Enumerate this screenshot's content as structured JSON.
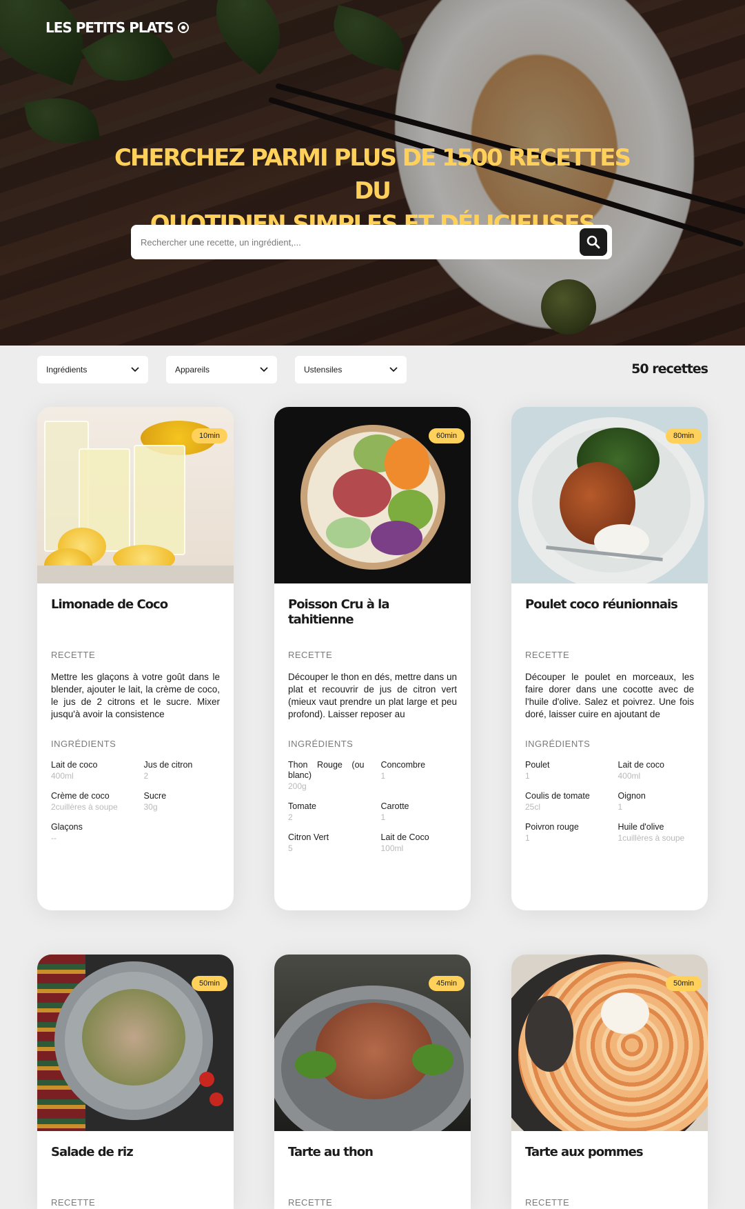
{
  "header": {
    "logo": "LES PETITS PLATS",
    "logo_icon": "target-icon",
    "headline_line1": "CHERCHEZ PARMI PLUS DE 1500 RECETTES DU",
    "headline_line2": "QUOTIDIEN,SIMPLES ET DÉLICIEUSES",
    "accent_color": "#FFD15B"
  },
  "search": {
    "placeholder": "Rechercher une recette, un ingrédient,...",
    "value": "",
    "icon": "search-icon"
  },
  "filters": [
    {
      "label": "Ingrédients",
      "icon": "chevron-down-icon"
    },
    {
      "label": "Appareils",
      "icon": "chevron-down-icon"
    },
    {
      "label": "Ustensiles",
      "icon": "chevron-down-icon"
    }
  ],
  "recipes_count": "50 recettes",
  "section_labels": {
    "recipe": "RECETTE",
    "ingredients": "INGRÉDIENTS"
  },
  "recipes": [
    {
      "time": "10min",
      "title": "Limonade de Coco",
      "description": "Mettre les glaçons à votre goût dans le blender, ajouter le lait, la crème de coco, le jus de 2 citrons et le sucre. Mixer jusqu'à avoir la consistence",
      "ingredients": [
        {
          "name": "Lait de coco",
          "qty": "400ml"
        },
        {
          "name": "Jus de citron",
          "qty": "2"
        },
        {
          "name": "Crème de coco",
          "qty": "2cuillères à soupe"
        },
        {
          "name": "Sucre",
          "qty": "30g"
        },
        {
          "name": "Glaçons",
          "qty": "--"
        }
      ]
    },
    {
      "time": "60min",
      "title": "Poisson Cru à la tahitienne",
      "description": "Découper le thon en dés, mettre dans un plat et recouvrir de jus de citron vert (mieux vaut prendre un plat large et peu profond). Laisser reposer au",
      "ingredients": [
        {
          "name": "Thon Rouge (ou blanc)",
          "qty": "200g"
        },
        {
          "name": "Concombre",
          "qty": "1"
        },
        {
          "name": "Tomate",
          "qty": "2"
        },
        {
          "name": "Carotte",
          "qty": "1"
        },
        {
          "name": "Citron Vert",
          "qty": "5"
        },
        {
          "name": "Lait de Coco",
          "qty": "100ml"
        }
      ]
    },
    {
      "time": "80min",
      "title": "Poulet coco réunionnais",
      "description": "Découper le poulet en morceaux, les faire dorer dans une cocotte avec de l'huile d'olive. Salez et poivrez. Une fois doré, laisser cuire en ajoutant de",
      "ingredients": [
        {
          "name": "Poulet",
          "qty": "1"
        },
        {
          "name": "Lait de coco",
          "qty": "400ml"
        },
        {
          "name": "Coulis de tomate",
          "qty": "25cl"
        },
        {
          "name": "Oignon",
          "qty": "1"
        },
        {
          "name": "Poivron rouge",
          "qty": "1"
        },
        {
          "name": "Huile d'olive",
          "qty": "1cuillères à soupe"
        }
      ]
    },
    {
      "time": "50min",
      "title": "Salade de riz"
    },
    {
      "time": "45min",
      "title": "Tarte au thon"
    },
    {
      "time": "50min",
      "title": "Tarte aux pommes"
    }
  ]
}
